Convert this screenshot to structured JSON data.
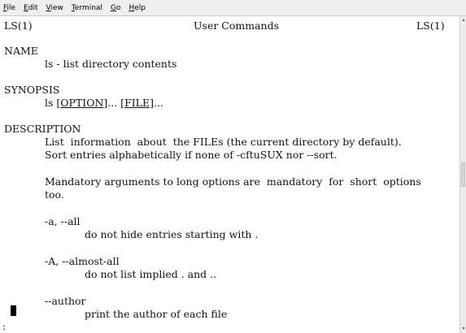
{
  "menubar": {
    "items": [
      {
        "mnemonic": "F",
        "rest": "ile"
      },
      {
        "mnemonic": "E",
        "rest": "dit"
      },
      {
        "mnemonic": "V",
        "rest": "iew"
      },
      {
        "mnemonic": "T",
        "rest": "erminal"
      },
      {
        "mnemonic": "G",
        "rest": "o"
      },
      {
        "mnemonic": "H",
        "rest": "elp"
      }
    ]
  },
  "man": {
    "header_left": "LS(1)",
    "header_center": "User Commands",
    "header_right": "LS(1)",
    "name_heading": "NAME",
    "name_line": "ls - list directory contents",
    "synopsis_heading": "SYNOPSIS",
    "synopsis_cmd": "ls ",
    "synopsis_opt_open": "[",
    "synopsis_opt": "OPTION",
    "synopsis_opt_close": "]... [",
    "synopsis_file": "FILE",
    "synopsis_end": "]...",
    "description_heading": "DESCRIPTION",
    "desc_line1": "List  information  about  the FILEs (the current directory by default).",
    "desc_line2": "Sort entries alphabetically if none of -cftuSUX nor --sort.",
    "mandatory_line1": "Mandatory arguments to long options are  mandatory  for  short  options",
    "mandatory_line2": "too.",
    "opt_a": "-a, --all",
    "opt_a_desc": "do not hide entries starting with .",
    "opt_A": "-A, --almost-all",
    "opt_A_desc": "do not list implied . and ..",
    "opt_author": "--author",
    "opt_author_desc": "print the author of each file",
    "prompt": ":"
  }
}
